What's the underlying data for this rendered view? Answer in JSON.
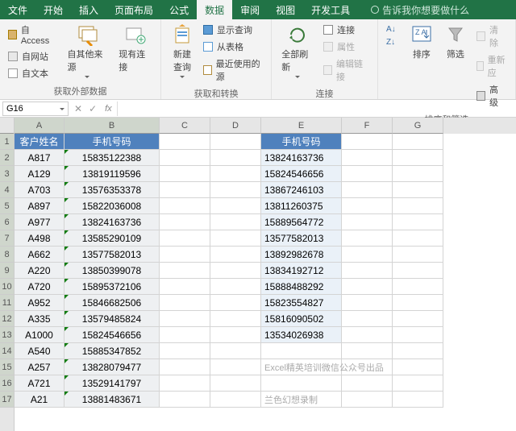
{
  "tabs": {
    "file": "文件",
    "home": "开始",
    "insert": "插入",
    "layout": "页面布局",
    "formula": "公式",
    "data": "数据",
    "review": "审阅",
    "view": "视图",
    "dev": "开发工具",
    "tell": "告诉我你想要做什么"
  },
  "ribbon": {
    "ext": {
      "access": "自 Access",
      "web": "自网站",
      "text": "自文本",
      "other": "自其他来源",
      "existing": "现有连接",
      "label": "获取外部数据"
    },
    "query": {
      "new": "新建\n查询",
      "show": "显示查询",
      "table": "从表格",
      "recent": "最近使用的源",
      "label": "获取和转换"
    },
    "conn": {
      "refresh": "全部刷新",
      "conn": "连接",
      "prop": "属性",
      "edit": "编辑链接",
      "label": "连接"
    },
    "sort": {
      "az": "A↓Z",
      "za": "Z↓A",
      "sort": "排序",
      "filter": "筛选",
      "clear": "清除",
      "reapply": "重新应",
      "adv": "高级",
      "label": "排序和筛选"
    }
  },
  "namebox": "G16",
  "cols": [
    "A",
    "B",
    "C",
    "D",
    "E",
    "F",
    "G"
  ],
  "header": {
    "name": "客户姓名",
    "phone": "手机号码",
    "phone2": "手机号码"
  },
  "tableAB": [
    [
      "A817",
      "15835122388"
    ],
    [
      "A129",
      "13819119596"
    ],
    [
      "A703",
      "13576353378"
    ],
    [
      "A897",
      "15822036008"
    ],
    [
      "A977",
      "13824163736"
    ],
    [
      "A498",
      "13585290109"
    ],
    [
      "A662",
      "13577582013"
    ],
    [
      "A220",
      "13850399078"
    ],
    [
      "A720",
      "15895372106"
    ],
    [
      "A952",
      "15846682506"
    ],
    [
      "A335",
      "13579485824"
    ],
    [
      "A1000",
      "15824546656"
    ],
    [
      "A540",
      "15885347852"
    ],
    [
      "A257",
      "13828079477"
    ],
    [
      "A721",
      "13529141797"
    ],
    [
      "A21",
      "13881483671"
    ]
  ],
  "tableE": [
    "13824163736",
    "15824546656",
    "13867246103",
    "13811260375",
    "15889564772",
    "13577582013",
    "13892982678",
    "13834192712",
    "15888488292",
    "15823554827",
    "15816090502",
    "13534026938"
  ],
  "watermark": {
    "l1": "Excel精英培训微信公众号出品",
    "l2": "兰色幻想录制"
  }
}
